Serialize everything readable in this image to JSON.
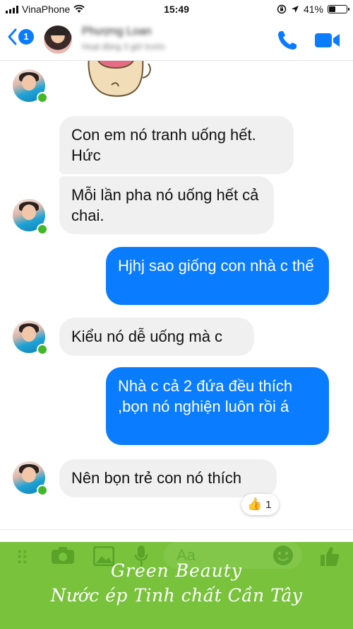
{
  "status_bar": {
    "carrier": "VinaPhone",
    "time": "15:49",
    "battery_percent": "41%",
    "battery_level": 0.41
  },
  "header": {
    "back_badge": "1",
    "contact_name": "Phượng Loan",
    "contact_status": "Hoạt động 3 giờ trước",
    "icons": [
      "back-chevron-icon",
      "phone-icon",
      "video-camera-icon"
    ],
    "accent_color": "#0a7cff"
  },
  "messages": [
    {
      "sender": "contact",
      "text": "Con em nó tranh uống hết. Hức"
    },
    {
      "sender": "contact",
      "text": "Mỗi lần pha nó uống hết cả chai."
    },
    {
      "sender": "me",
      "text": "Hjhj sao giống con nhà c thế"
    },
    {
      "sender": "contact",
      "text": "Kiểu nó dễ uống mà c"
    },
    {
      "sender": "me",
      "text": "Nhà c cả 2 đứa đều thích ,bọn nó nghiện luôn rồi á"
    },
    {
      "sender": "contact",
      "text": "Nên bọn trẻ con nó thích"
    }
  ],
  "reaction": {
    "icon": "thumbs-up-icon",
    "count": "1"
  },
  "composer": {
    "placeholder": "Aa"
  },
  "banner": {
    "line1": "Green Beauty",
    "line2": "Nước ép Tinh chất Cần Tây",
    "color": "#79c23c"
  }
}
